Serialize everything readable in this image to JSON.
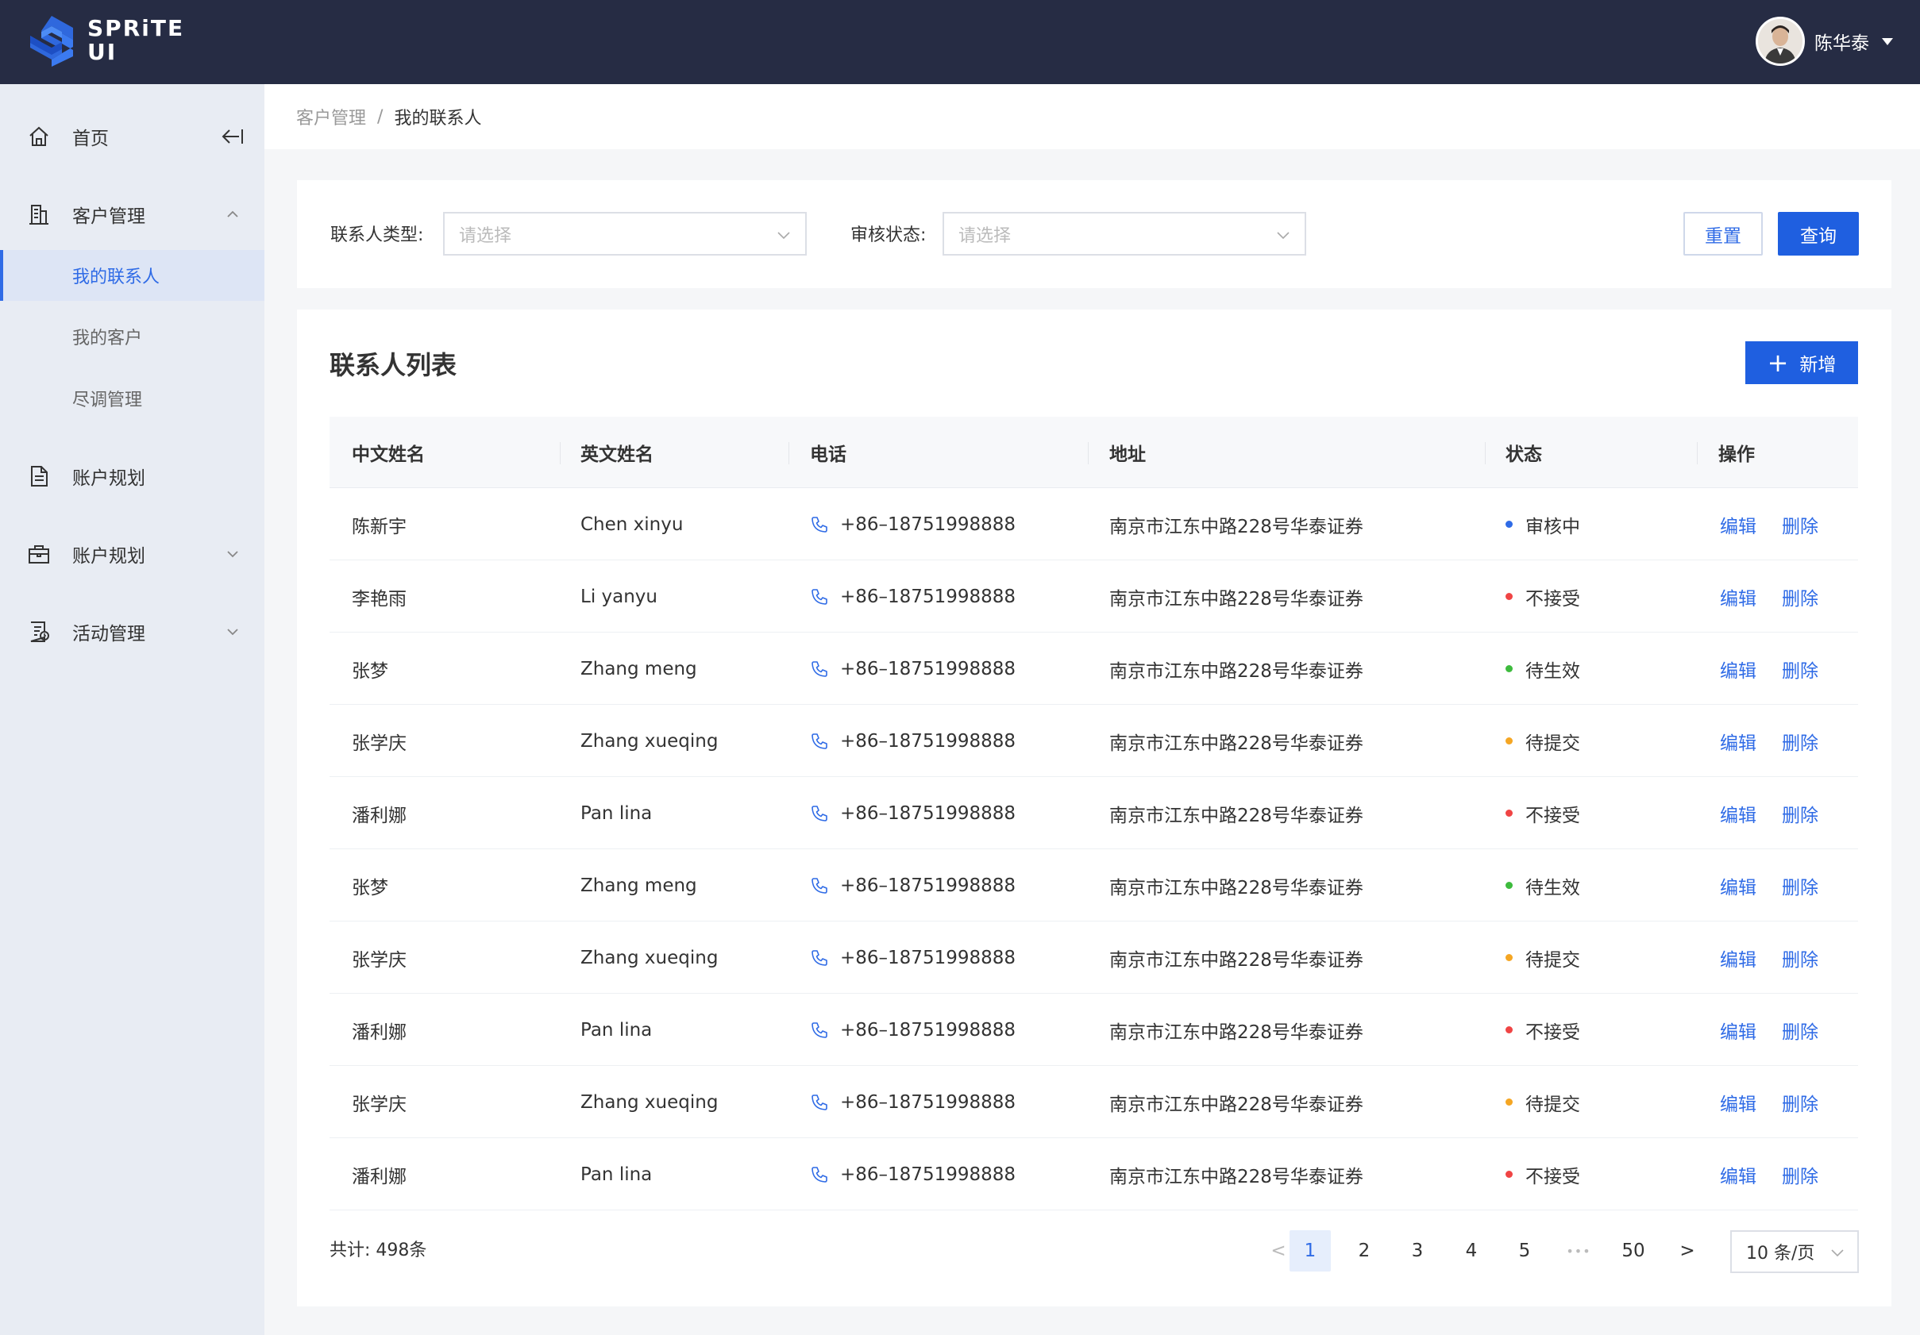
{
  "header": {
    "brand_line1": "SPRiTE",
    "brand_line2": "UI",
    "user_name": "陈华泰"
  },
  "sidebar": {
    "home": "首页",
    "customer_mgmt": "客户管理",
    "sub_items": [
      "我的联系人",
      "我的客户",
      "尽调管理"
    ],
    "account_plan_1": "账户规划",
    "account_plan_2": "账户规划",
    "activity_mgmt": "活动管理"
  },
  "breadcrumb": {
    "parent": "客户管理",
    "separator": "/",
    "current": "我的联系人"
  },
  "filters": {
    "contact_type_label": "联系人类型:",
    "contact_type_placeholder": "请选择",
    "review_status_label": "审核状态:",
    "review_status_placeholder": "请选择",
    "reset_label": "重置",
    "query_label": "查询"
  },
  "list": {
    "title": "联系人列表",
    "add_label": "新增",
    "columns": [
      "中文姓名",
      "英文姓名",
      "电话",
      "地址",
      "状态",
      "操作"
    ],
    "actions": {
      "edit": "编辑",
      "delete": "删除"
    },
    "rows": [
      {
        "cn": "陈新宇",
        "en": "Chen xinyu",
        "phone": "+86–18751998888",
        "address": "南京市江东中路228号华泰证券",
        "status": "审核中",
        "status_color": "#2f6be6"
      },
      {
        "cn": "李艳雨",
        "en": "Li yanyu",
        "phone": "+86–18751998888",
        "address": "南京市江东中路228号华泰证券",
        "status": "不接受",
        "status_color": "#f04444"
      },
      {
        "cn": "张梦",
        "en": "Zhang meng",
        "phone": "+86–18751998888",
        "address": "南京市江东中路228号华泰证券",
        "status": "待生效",
        "status_color": "#3dbb3d"
      },
      {
        "cn": "张学庆",
        "en": "Zhang xueqing",
        "phone": "+86–18751998888",
        "address": "南京市江东中路228号华泰证券",
        "status": "待提交",
        "status_color": "#f5a623"
      },
      {
        "cn": "潘利娜",
        "en": "Pan lina",
        "phone": "+86–18751998888",
        "address": "南京市江东中路228号华泰证券",
        "status": "不接受",
        "status_color": "#f04444"
      },
      {
        "cn": "张梦",
        "en": "Zhang meng",
        "phone": "+86–18751998888",
        "address": "南京市江东中路228号华泰证券",
        "status": "待生效",
        "status_color": "#3dbb3d"
      },
      {
        "cn": "张学庆",
        "en": "Zhang xueqing",
        "phone": "+86–18751998888",
        "address": "南京市江东中路228号华泰证券",
        "status": "待提交",
        "status_color": "#f5a623"
      },
      {
        "cn": "潘利娜",
        "en": "Pan lina",
        "phone": "+86–18751998888",
        "address": "南京市江东中路228号华泰证券",
        "status": "不接受",
        "status_color": "#f04444"
      },
      {
        "cn": "张学庆",
        "en": "Zhang xueqing",
        "phone": "+86–18751998888",
        "address": "南京市江东中路228号华泰证券",
        "status": "待提交",
        "status_color": "#f5a623"
      },
      {
        "cn": "潘利娜",
        "en": "Pan lina",
        "phone": "+86–18751998888",
        "address": "南京市江东中路228号华泰证券",
        "status": "不接受",
        "status_color": "#f04444"
      }
    ]
  },
  "pagination": {
    "total_text": "共计: 498条",
    "pages": [
      "1",
      "2",
      "3",
      "4",
      "5"
    ],
    "ellipsis": "•••",
    "last_page": "50",
    "current_page": "1",
    "page_size": "10 条/页",
    "prev_symbol": "<",
    "next_symbol": ">"
  },
  "colors": {
    "topbar": "#262c44",
    "accent": "#2f6be6",
    "primary_button": "#1f5fe0",
    "sidebar": "#e8ecf3"
  }
}
